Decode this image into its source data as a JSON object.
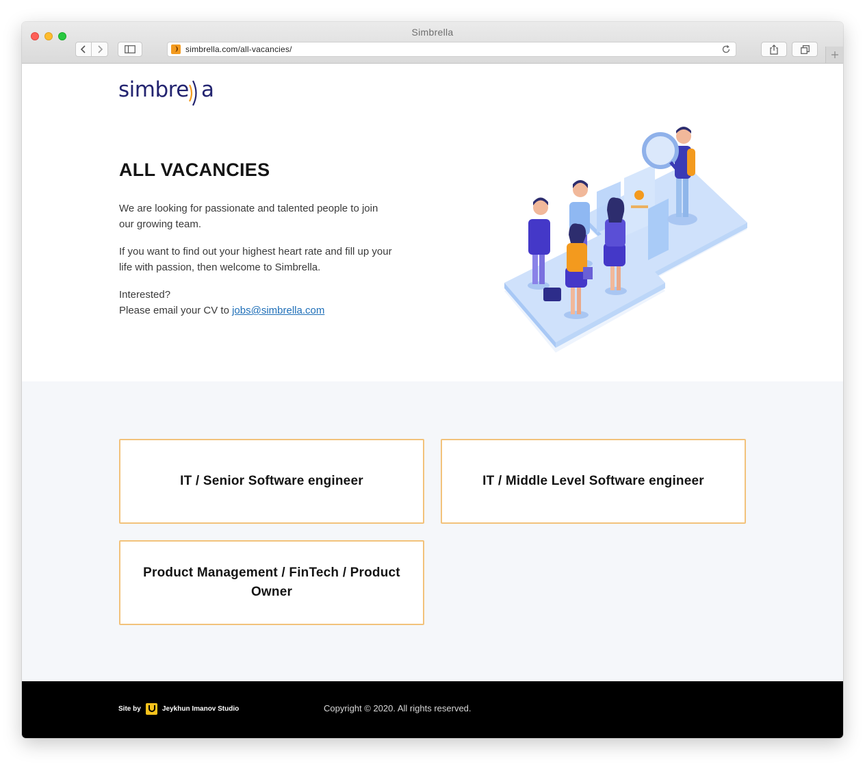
{
  "browser": {
    "window_title": "Simbrella",
    "url": "simbrella.com/all-vacancies/"
  },
  "header": {
    "logo_text": "simbre",
    "logo_tail": "a"
  },
  "hero": {
    "title": "ALL VACANCIES",
    "paragraph_1": "We are looking for passionate and talented people to join our growing team.",
    "paragraph_2": "If you want to find out your highest heart rate and fill up your life with passion, then welcome to Simbrella.",
    "interested": "Interested?",
    "email_prefix": "Please email your CV to ",
    "email": "jobs@simbrella.com"
  },
  "vacancies": [
    {
      "title": "IT / Senior Software engineer"
    },
    {
      "title": "IT / Middle Level Software engineer"
    },
    {
      "title": "Product Management / FinTech / Product Owner"
    }
  ],
  "footer": {
    "site_by": "Site by",
    "studio": "Jeykhun Imanov Studio",
    "copyright": "Copyright © 2020. All rights reserved."
  },
  "colors": {
    "brand_navy": "#232470",
    "brand_orange": "#f39a1e",
    "card_border": "#f2c27b",
    "link": "#1f6fb8",
    "section_bg": "#f5f7fa",
    "footer_bg": "#000000"
  },
  "icons": [
    "back-chevron-icon",
    "forward-chevron-icon",
    "sidebar-icon",
    "reload-icon",
    "share-icon",
    "tabs-icon",
    "plus-icon"
  ]
}
